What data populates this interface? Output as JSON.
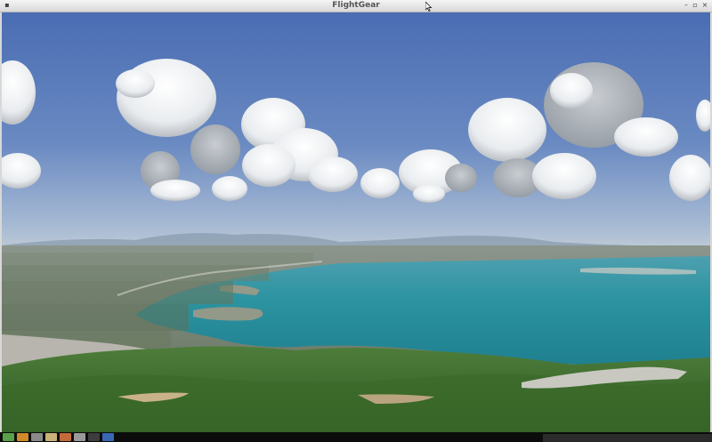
{
  "window": {
    "title": "FlightGear"
  },
  "colors": {
    "sky_top": "#4a6eb4",
    "sky_horizon": "#a9bcd4",
    "water": "#2a8e9a",
    "hills": "#3d6b2c"
  },
  "icons": {
    "menu": "window-menu-icon",
    "minimize": "minimize-icon",
    "maximize": "maximize-icon",
    "close": "close-icon"
  },
  "taskbar": {
    "items": [
      {
        "name": "taskbar-app-1",
        "color": "#5aa04a"
      },
      {
        "name": "taskbar-app-2",
        "color": "#d08a2a"
      },
      {
        "name": "taskbar-app-3",
        "color": "#8a8a8a"
      },
      {
        "name": "taskbar-app-4",
        "color": "#c9b27a"
      },
      {
        "name": "taskbar-app-5",
        "color": "#c46a3a"
      },
      {
        "name": "taskbar-app-6",
        "color": "#9a9a9a"
      },
      {
        "name": "taskbar-app-7",
        "color": "#3d3d3d"
      },
      {
        "name": "taskbar-app-8",
        "color": "#3a67b5"
      }
    ]
  }
}
